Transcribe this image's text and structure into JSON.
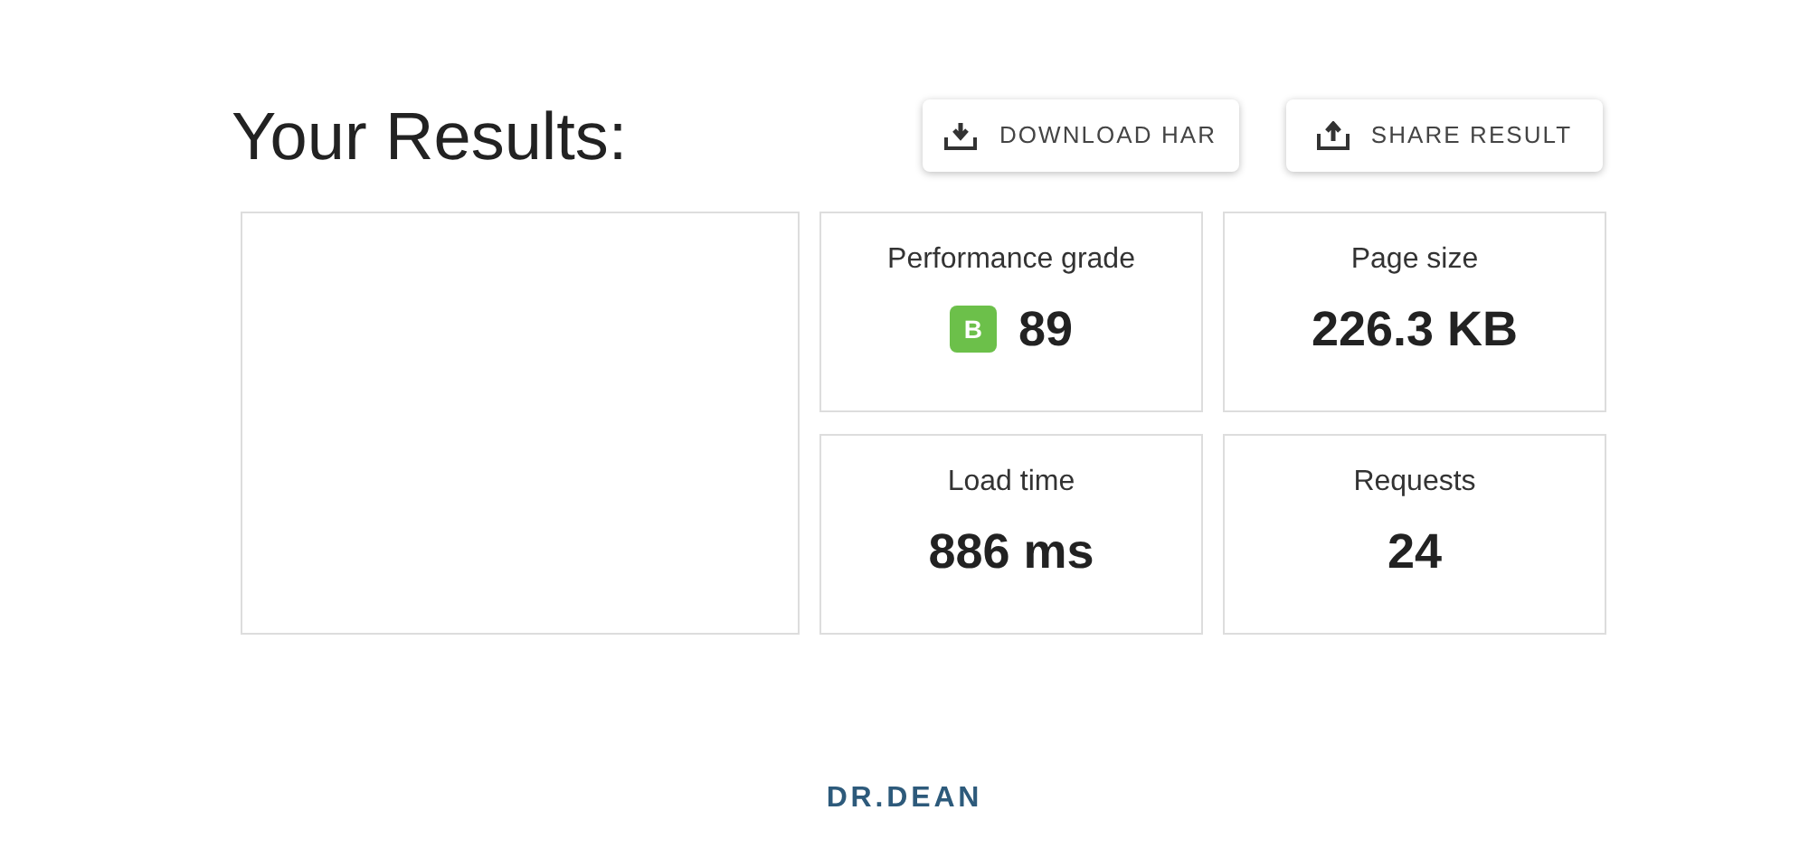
{
  "title": "Your Results:",
  "buttons": [
    {
      "label": "DOWNLOAD HAR",
      "kind": "download"
    },
    {
      "label": "SHARE RESULT",
      "kind": "share"
    }
  ],
  "screenshot": {
    "kind": "blank"
  },
  "metrics": [
    {
      "label": "Performance grade",
      "value": "89",
      "grade": "B",
      "color": "#6cc04a"
    },
    {
      "label": "Page size",
      "value": "226.3 KB"
    },
    {
      "label": "Load time",
      "value": "886 ms"
    },
    {
      "label": "Requests",
      "value": "24"
    }
  ],
  "footer_logo": "DR.DEAN"
}
